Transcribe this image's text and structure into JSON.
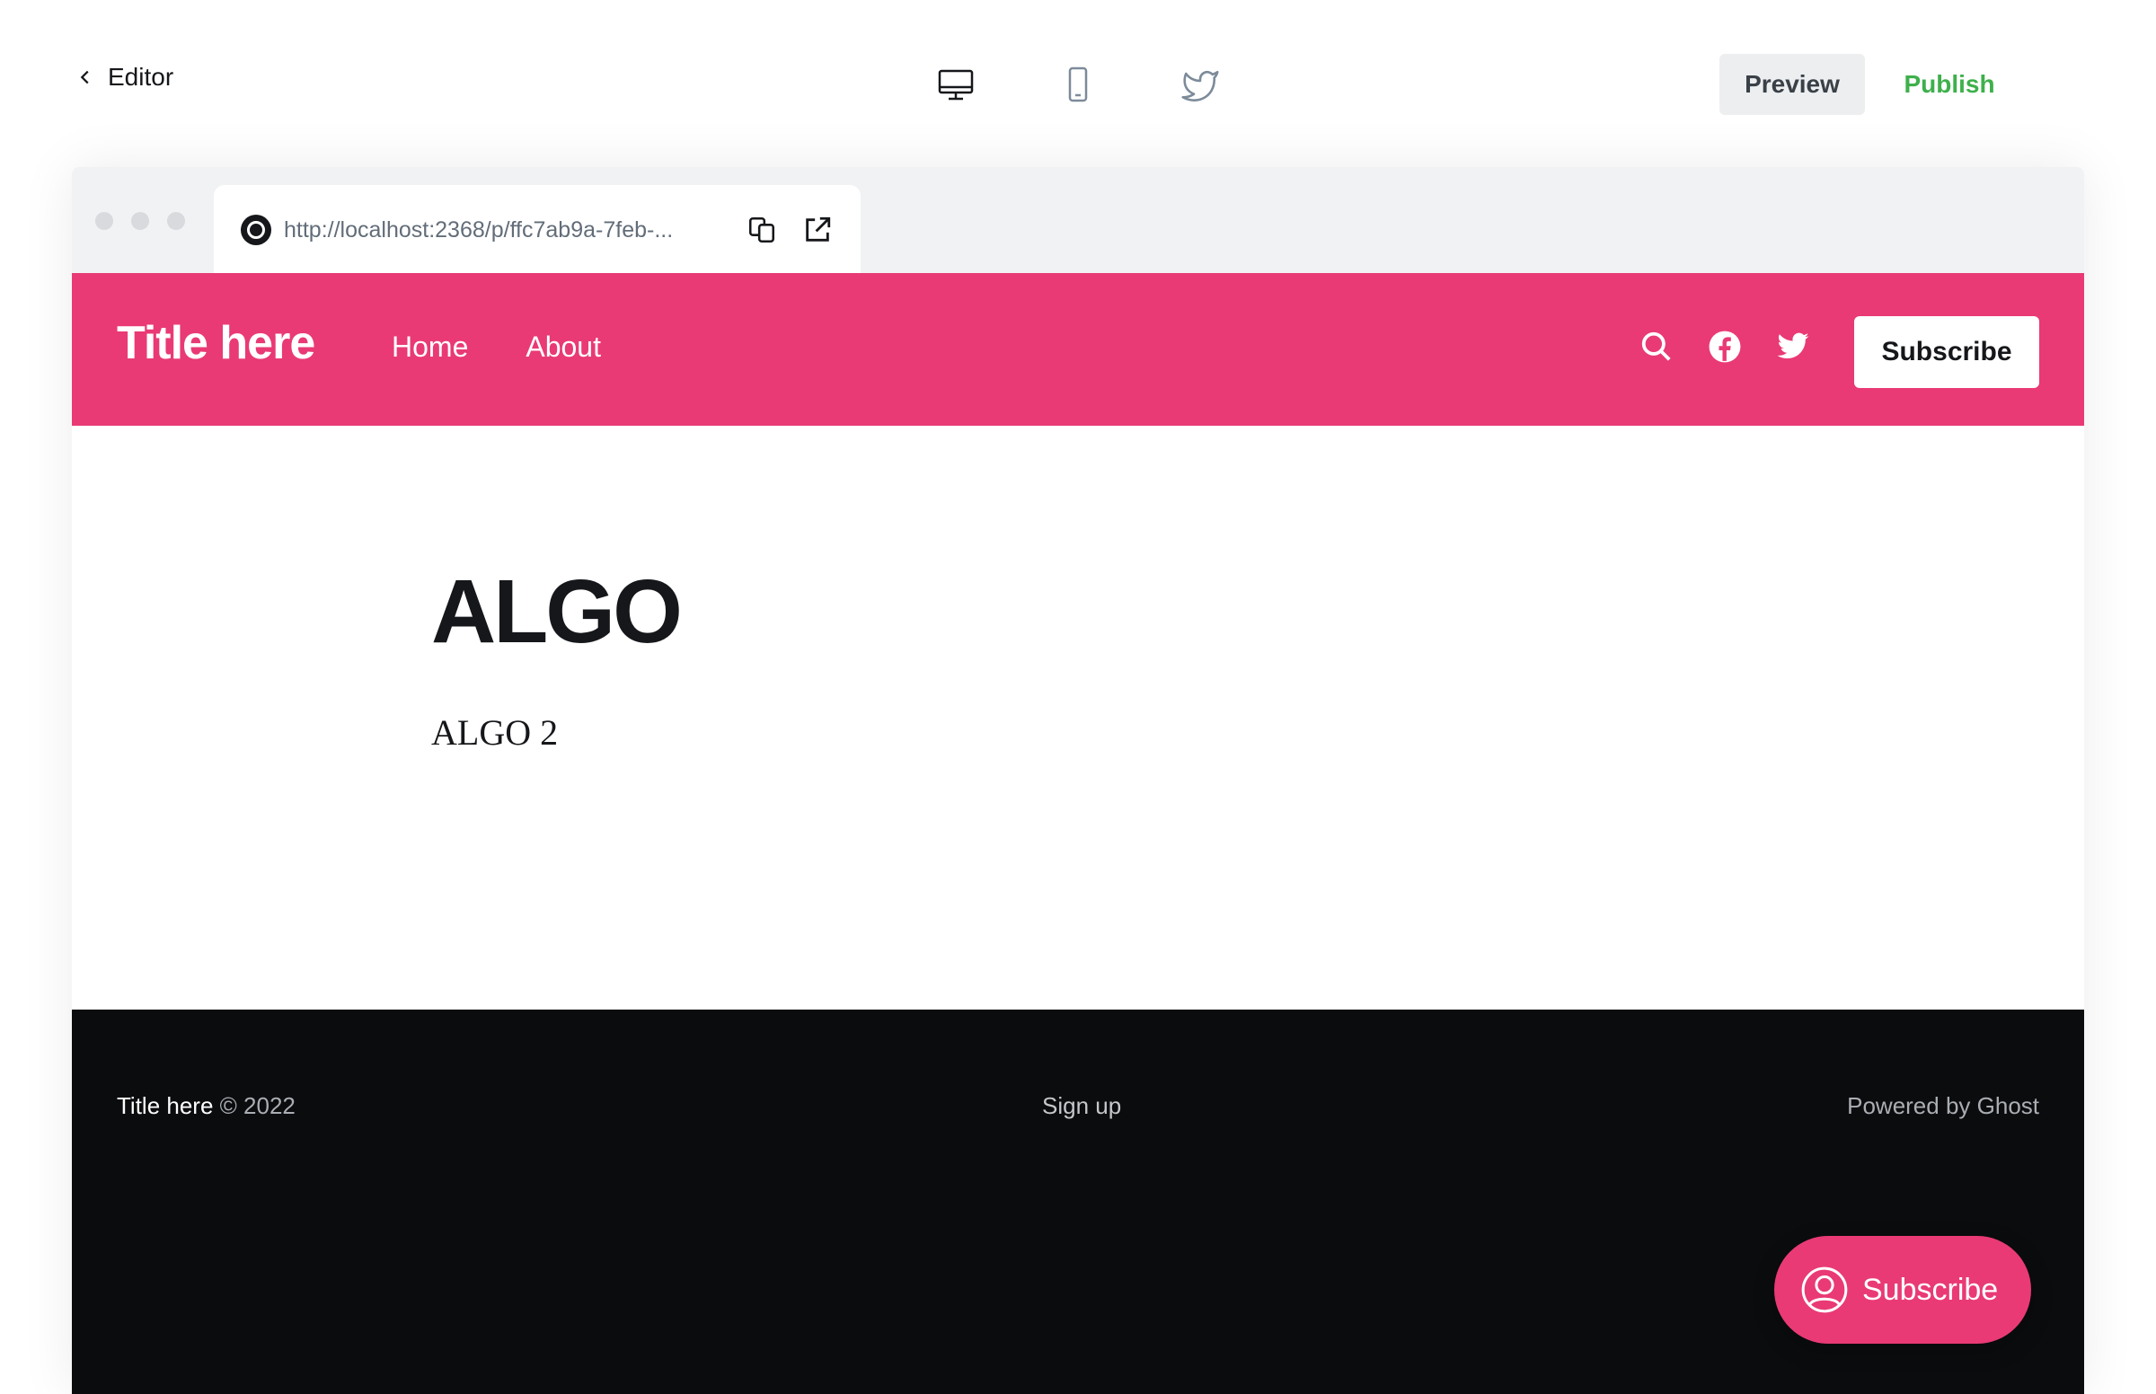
{
  "editor_bar": {
    "back_label": "Editor",
    "devices": [
      {
        "icon": "desktop-icon",
        "active": true
      },
      {
        "icon": "mobile-icon",
        "active": false
      },
      {
        "icon": "twitter-icon",
        "active": false
      }
    ],
    "preview_label": "Preview",
    "publish_label": "Publish",
    "publish_color": "#3eb04b"
  },
  "browser": {
    "url": "http://localhost:2368/p/ffc7ab9a-7feb-..."
  },
  "site": {
    "accent_color": "#e93a75",
    "title": "Title here",
    "nav": [
      "Home",
      "About"
    ],
    "subscribe_label": "Subscribe"
  },
  "post": {
    "title": "ALGO",
    "body": "ALGO 2"
  },
  "footer": {
    "site_title": "Title here",
    "copyright": "© 2022",
    "signup_label": "Sign up",
    "powered_by": "Powered by Ghost"
  },
  "portal": {
    "label": "Subscribe"
  }
}
